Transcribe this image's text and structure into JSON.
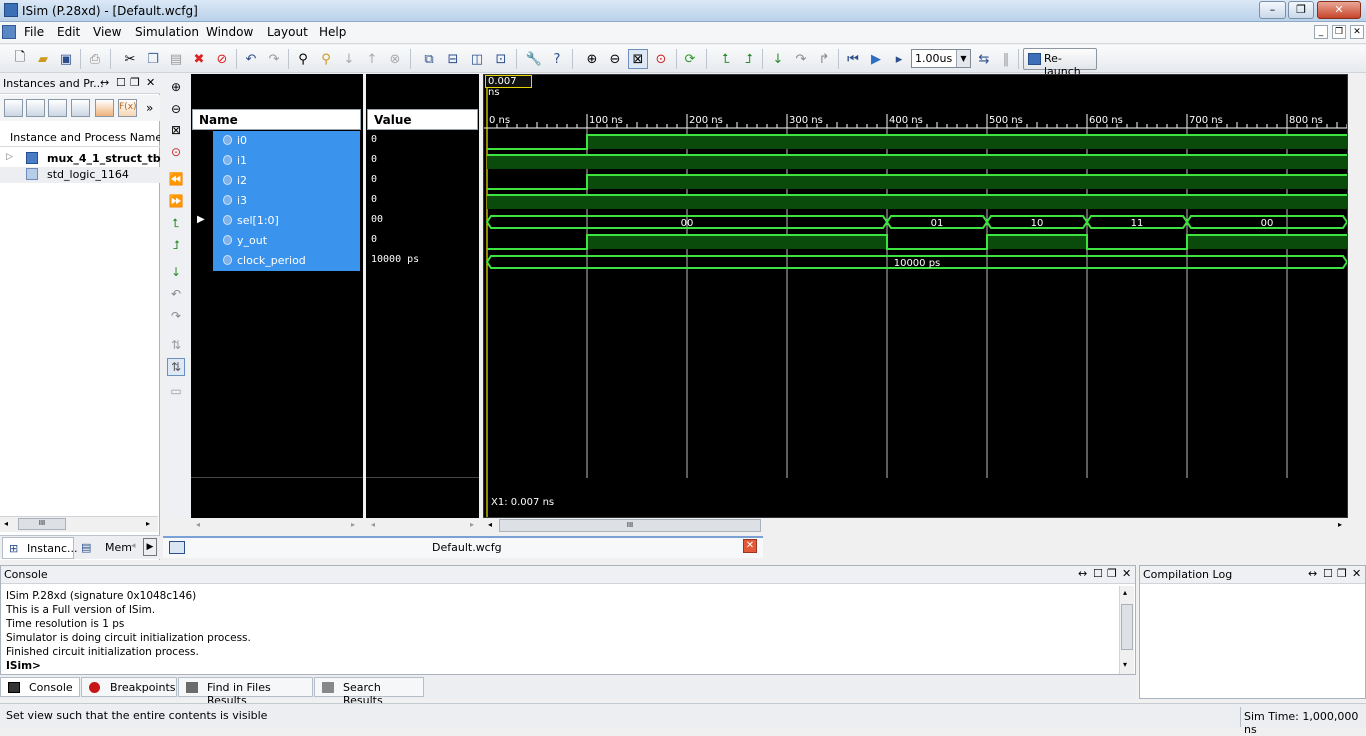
{
  "window": {
    "title": "ISim (P.28xd) - [Default.wcfg]"
  },
  "menu": [
    {
      "label": "File"
    },
    {
      "label": "Edit"
    },
    {
      "label": "View"
    },
    {
      "label": "Simulation"
    },
    {
      "label": "Window"
    },
    {
      "label": "Layout"
    },
    {
      "label": "Help"
    }
  ],
  "toolbar": {
    "zoom_value": "1.00us",
    "relaunch_label": "Re-launch"
  },
  "instances_panel": {
    "title": "Instances and Pr...",
    "column_header": "Instance and Process Name",
    "items": [
      {
        "label": "mux_4_1_struct_tb",
        "bold": true
      },
      {
        "label": "std_logic_1164",
        "bold": false
      }
    ],
    "tabs": [
      {
        "label": "Instanc..."
      },
      {
        "label": "Mem"
      }
    ]
  },
  "wave": {
    "name_header": "Name",
    "value_header": "Value",
    "cursor_time": "0.007 ns",
    "x1_label": "X1: 0.007 ns",
    "time_ticks": [
      "0 ns",
      "100 ns",
      "200 ns",
      "300 ns",
      "400 ns",
      "500 ns",
      "600 ns",
      "700 ns",
      "800 ns"
    ],
    "signals": [
      {
        "name": "i0",
        "value": "0"
      },
      {
        "name": "i1",
        "value": "0"
      },
      {
        "name": "i2",
        "value": "0"
      },
      {
        "name": "i3",
        "value": "0"
      },
      {
        "name": "sel[1:0]",
        "value": "00"
      },
      {
        "name": "y_out",
        "value": "0"
      },
      {
        "name": "clock_period",
        "value": "10000 ps"
      }
    ],
    "bus_labels": {
      "sel": [
        "00",
        "01",
        "10",
        "11",
        "00"
      ],
      "clock_period": "10000 ps"
    }
  },
  "doc_tab": {
    "label": "Default.wcfg"
  },
  "console": {
    "title": "Console",
    "lines": [
      "ISim P.28xd (signature 0x1048c146)",
      "This is a Full version of ISim.",
      "Time resolution is 1 ps",
      "Simulator is doing circuit initialization process.",
      "Finished circuit initialization process.",
      "ISim>"
    ]
  },
  "bottom_tabs": [
    {
      "label": "Console"
    },
    {
      "label": "Breakpoints"
    },
    {
      "label": "Find in Files Results"
    },
    {
      "label": "Search Results"
    }
  ],
  "compilation_log": {
    "title": "Compilation Log"
  },
  "status": {
    "text": "Set view such that the entire contents is visible",
    "sim_time": "Sim Time: 1,000,000 ns"
  },
  "colors": {
    "wave_green": "#3fe33f",
    "selection_blue": "#3a93ec",
    "high_fill": "#0a4a0a"
  }
}
